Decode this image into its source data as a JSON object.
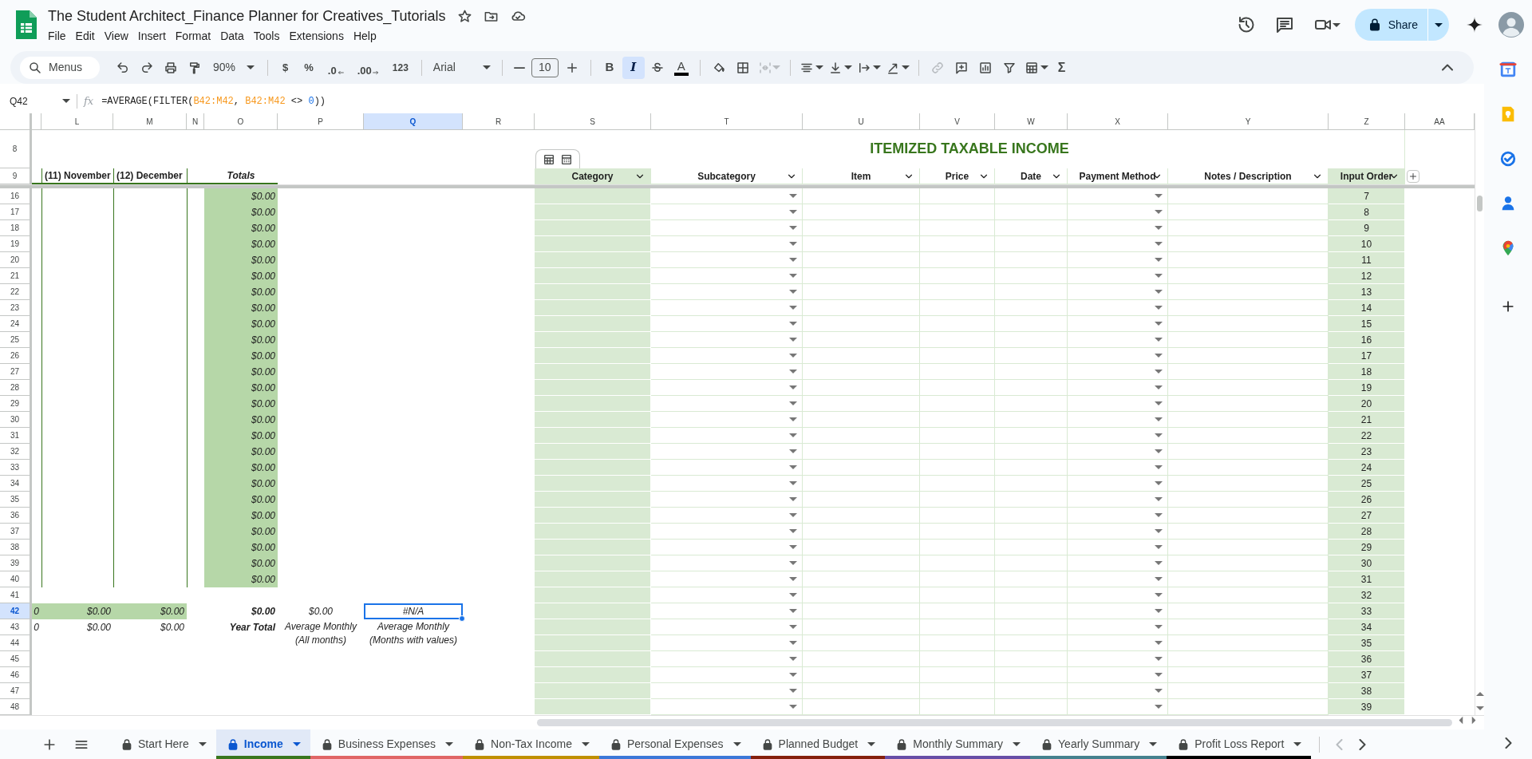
{
  "document": {
    "title": "The Student Architect_Finance Planner for Creatives_Tutorials",
    "menu": [
      "File",
      "Edit",
      "View",
      "Insert",
      "Format",
      "Data",
      "Tools",
      "Extensions",
      "Help"
    ],
    "share": "Share"
  },
  "toolbar": {
    "search": "Menus",
    "zoom": "90%",
    "currency": "$",
    "percent": "%",
    "fewer_decimals": ".0",
    "more_decimals": ".00",
    "number_format": "123",
    "font": "Arial",
    "font_size": "10",
    "styles": [
      {
        "kind": "bold",
        "label": "B",
        "selected": false
      },
      {
        "kind": "italic",
        "label": "I",
        "selected": true
      }
    ],
    "text_color": "A",
    "sum": "Σ"
  },
  "formula_bar": {
    "cell": "Q42",
    "label": "fx",
    "formula": [
      {
        "text": "=AVERAGE(FILTER(",
        "kind": "plain"
      },
      {
        "text": "B42:M42",
        "kind": "range"
      },
      {
        "text": ", ",
        "kind": "plain"
      },
      {
        "text": "B42:M42",
        "kind": "range"
      },
      {
        "text": " <> ",
        "kind": "plain"
      },
      {
        "text": "0",
        "kind": "number"
      },
      {
        "text": "))",
        "kind": "plain"
      }
    ]
  },
  "sheet": {
    "columns": [
      {
        "label": "L",
        "selected": false
      },
      {
        "label": "M",
        "selected": false
      },
      {
        "label": "N",
        "selected": false
      },
      {
        "label": "O",
        "selected": false
      },
      {
        "label": "P",
        "selected": false
      },
      {
        "label": "Q",
        "selected": true
      },
      {
        "label": "R",
        "selected": false
      },
      {
        "label": "S",
        "selected": false
      },
      {
        "label": "T",
        "selected": false
      },
      {
        "label": "U",
        "selected": false
      },
      {
        "label": "V",
        "selected": false
      },
      {
        "label": "W",
        "selected": false
      },
      {
        "label": "X",
        "selected": false
      },
      {
        "label": "Y",
        "selected": false
      },
      {
        "label": "Z",
        "selected": false
      },
      {
        "label": "AA",
        "selected": false
      }
    ],
    "title_row": {
      "number": "8",
      "title": "ITEMIZED TAXABLE INCOME"
    },
    "header_row": {
      "number": "9",
      "months": [
        "(11) November",
        "(12) December"
      ],
      "totals": "Totals"
    },
    "table_headers": [
      {
        "label": "Category",
        "highlighted": true
      },
      {
        "label": "Subcategory",
        "highlighted": false
      },
      {
        "label": "Item",
        "highlighted": false
      },
      {
        "label": "Price",
        "highlighted": false
      },
      {
        "label": "Date",
        "highlighted": false
      },
      {
        "label": "Payment Method",
        "highlighted": false
      },
      {
        "label": "Notes / Description",
        "highlighted": false
      },
      {
        "label": "Input Order",
        "highlighted": true
      }
    ],
    "rows": [
      {
        "number": "16",
        "kind": "entry",
        "selected": false,
        "total": "$0.00",
        "input_order": "7"
      },
      {
        "number": "17",
        "kind": "entry",
        "selected": false,
        "total": "$0.00",
        "input_order": "8"
      },
      {
        "number": "18",
        "kind": "entry",
        "selected": false,
        "total": "$0.00",
        "input_order": "9"
      },
      {
        "number": "19",
        "kind": "entry",
        "selected": false,
        "total": "$0.00",
        "input_order": "10"
      },
      {
        "number": "20",
        "kind": "entry",
        "selected": false,
        "total": "$0.00",
        "input_order": "11"
      },
      {
        "number": "21",
        "kind": "entry",
        "selected": false,
        "total": "$0.00",
        "input_order": "12"
      },
      {
        "number": "22",
        "kind": "entry",
        "selected": false,
        "total": "$0.00",
        "input_order": "13"
      },
      {
        "number": "23",
        "kind": "entry",
        "selected": false,
        "total": "$0.00",
        "input_order": "14"
      },
      {
        "number": "24",
        "kind": "entry",
        "selected": false,
        "total": "$0.00",
        "input_order": "15"
      },
      {
        "number": "25",
        "kind": "entry",
        "selected": false,
        "total": "$0.00",
        "input_order": "16"
      },
      {
        "number": "26",
        "kind": "entry",
        "selected": false,
        "total": "$0.00",
        "input_order": "17"
      },
      {
        "number": "27",
        "kind": "entry",
        "selected": false,
        "total": "$0.00",
        "input_order": "18"
      },
      {
        "number": "28",
        "kind": "entry",
        "selected": false,
        "total": "$0.00",
        "input_order": "19"
      },
      {
        "number": "29",
        "kind": "entry",
        "selected": false,
        "total": "$0.00",
        "input_order": "20"
      },
      {
        "number": "30",
        "kind": "entry",
        "selected": false,
        "total": "$0.00",
        "input_order": "21"
      },
      {
        "number": "31",
        "kind": "entry",
        "selected": false,
        "total": "$0.00",
        "input_order": "22"
      },
      {
        "number": "32",
        "kind": "entry",
        "selected": false,
        "total": "$0.00",
        "input_order": "23"
      },
      {
        "number": "33",
        "kind": "entry",
        "selected": false,
        "total": "$0.00",
        "input_order": "24"
      },
      {
        "number": "34",
        "kind": "entry",
        "selected": false,
        "total": "$0.00",
        "input_order": "25"
      },
      {
        "number": "35",
        "kind": "entry",
        "selected": false,
        "total": "$0.00",
        "input_order": "26"
      },
      {
        "number": "36",
        "kind": "entry",
        "selected": false,
        "total": "$0.00",
        "input_order": "27"
      },
      {
        "number": "37",
        "kind": "entry",
        "selected": false,
        "total": "$0.00",
        "input_order": "28"
      },
      {
        "number": "38",
        "kind": "entry",
        "selected": false,
        "total": "$0.00",
        "input_order": "29"
      },
      {
        "number": "39",
        "kind": "entry",
        "selected": false,
        "total": "$0.00",
        "input_order": "30"
      },
      {
        "number": "40",
        "kind": "entry",
        "selected": false,
        "total": "$0.00",
        "input_order": "31"
      },
      {
        "number": "41",
        "kind": "blank",
        "selected": false,
        "input_order": "32"
      },
      {
        "number": "42",
        "kind": "totals",
        "selected": true,
        "months": [
          "0",
          "$0.00",
          "$0.00"
        ],
        "total": "$0.00",
        "average_all": "$0.00",
        "average_values": "#N/A",
        "input_order": "33"
      },
      {
        "number": "43",
        "kind": "labels",
        "selected": false,
        "months": [
          "0",
          "$0.00",
          "$0.00"
        ],
        "total": "Year Total",
        "average_all": "Average Monthly\n(All months)",
        "average_values": "Average Monthly\n(Months with values)",
        "input_order": "34"
      },
      {
        "number": "44",
        "kind": "blank",
        "selected": false,
        "input_order": "35"
      },
      {
        "number": "45",
        "kind": "blank",
        "selected": false,
        "input_order": "36"
      },
      {
        "number": "46",
        "kind": "blank",
        "selected": false,
        "input_order": "37"
      },
      {
        "number": "47",
        "kind": "blank",
        "selected": false,
        "input_order": "38"
      },
      {
        "number": "48",
        "kind": "blank",
        "selected": false,
        "input_order": "39"
      }
    ]
  },
  "sheet_tabs": [
    {
      "label": "Start Here",
      "locked": true,
      "selected": false
    },
    {
      "label": "Income",
      "locked": true,
      "selected": true,
      "color": "#38761d"
    },
    {
      "label": "Business Expenses",
      "locked": true,
      "selected": false,
      "color": "#e06666"
    },
    {
      "label": "Non-Tax Income",
      "locked": true,
      "selected": false,
      "color": "#bf9000"
    },
    {
      "label": "Personal Expenses",
      "locked": true,
      "selected": false,
      "color": "#3c78d8"
    },
    {
      "label": "Planned Budget",
      "locked": true,
      "selected": false,
      "color": "#85200c"
    },
    {
      "label": "Monthly Summary",
      "locked": true,
      "selected": false,
      "color": "#674ea7"
    },
    {
      "label": "Yearly Summary",
      "locked": true,
      "selected": false,
      "color": "#45818e"
    },
    {
      "label": "Profit Loss Report",
      "locked": true,
      "selected": false,
      "color": "#000000"
    }
  ]
}
